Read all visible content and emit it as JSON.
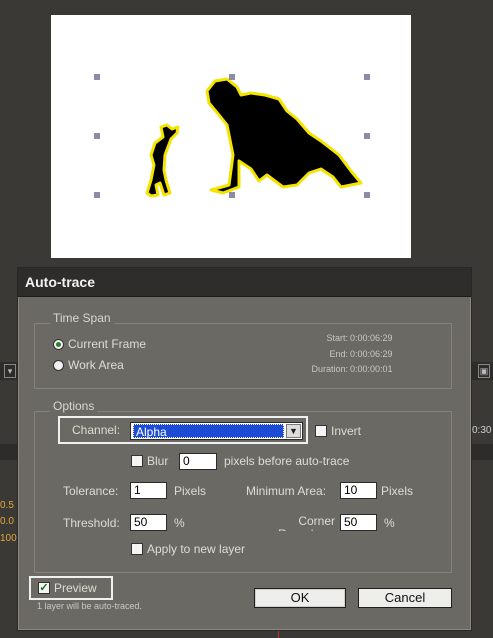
{
  "dialog": {
    "title": "Auto-trace",
    "time_span": {
      "title": "Time Span",
      "options": [
        "Current Frame",
        "Work Area"
      ],
      "selected": "Current Frame",
      "start_label": "Start:",
      "start_value": "0:00:06:29",
      "end_label": "End:",
      "end_value": "0:00:06:29",
      "duration_label": "Duration:",
      "duration_value": "0:00:00:01"
    },
    "options": {
      "title": "Options",
      "channel_label": "Channel:",
      "channel_value": "Alpha",
      "invert_label": "Invert",
      "invert_checked": false,
      "blur_label": "Blur",
      "blur_checked": false,
      "blur_value": "0",
      "blur_suffix": "pixels before auto-trace",
      "tolerance_label": "Tolerance:",
      "tolerance_value": "1",
      "tolerance_unit": "Pixels",
      "min_area_label": "Minimum Area:",
      "min_area_value": "10",
      "min_area_unit": "Pixels",
      "threshold_label": "Threshold:",
      "threshold_value": "50",
      "threshold_unit": "%",
      "corner_label": "Corner Roundness:",
      "corner_value": "50",
      "corner_unit": "%",
      "apply_label": "Apply to new layer",
      "apply_checked": false
    },
    "preview_label": "Preview",
    "preview_checked": true,
    "status": "1 layer will be auto-traced.",
    "ok_label": "OK",
    "cancel_label": "Cancel"
  },
  "background": {
    "edge_labels": [
      "0.5",
      "0.0",
      "100",
      "0:30"
    ]
  },
  "colors": {
    "dialog_bg": "#6b6963",
    "titlebar": "#2f2d2b",
    "selection": "#1c4bd6",
    "trace_outline": "#f4e400"
  }
}
